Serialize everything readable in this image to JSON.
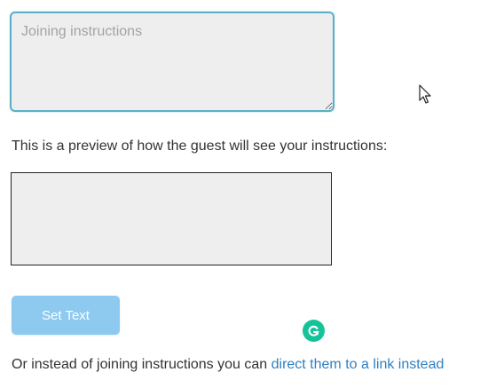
{
  "instructions": {
    "placeholder": "Joining instructions",
    "value": ""
  },
  "preview": {
    "label": "This is a preview of how the guest will see your instructions:",
    "content": ""
  },
  "actions": {
    "set_text_label": "Set Text"
  },
  "footer": {
    "prefix": "Or instead of joining instructions you can ",
    "link_text": "direct them to a link instead"
  },
  "icons": {
    "grammarly": "grammarly-icon",
    "cursor": "mouse-pointer-icon"
  },
  "colors": {
    "textarea_border": "#5ab0c8",
    "field_background": "#eeeeee",
    "button_background": "#8ec9f0",
    "link": "#2f7fc1",
    "grammarly_green": "#15c39a"
  }
}
